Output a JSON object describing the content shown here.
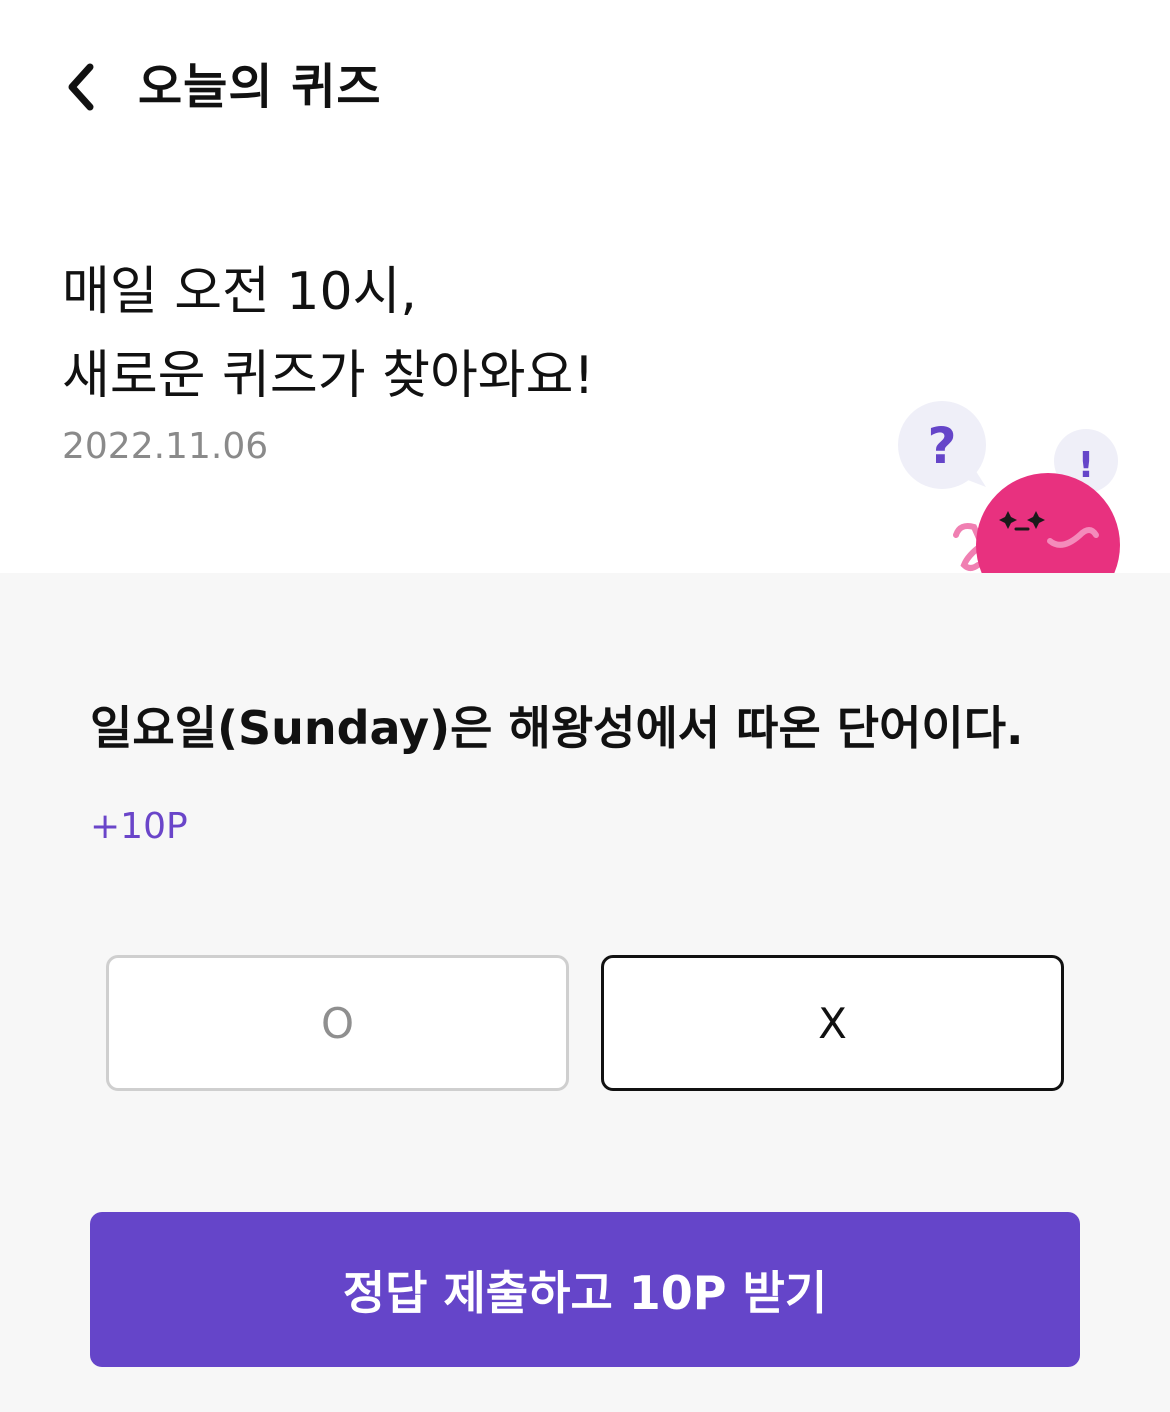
{
  "header": {
    "title": "오늘의 퀴즈",
    "back_icon": "chevron-left-icon"
  },
  "intro": {
    "line1": "매일 오전 10시,",
    "line2": "새로운 퀴즈가 찾아와요!",
    "date": "2022.11.06"
  },
  "mascot": {
    "question_mark": "?",
    "exclamation_mark": "!"
  },
  "quiz": {
    "question": "일요일(Sunday)은 해왕성에서 따온 단어이다.",
    "points": "+10P",
    "options": [
      {
        "label": "O",
        "selected": false
      },
      {
        "label": "X",
        "selected": true
      }
    ]
  },
  "submit": {
    "label": "정답 제출하고 10P 받기"
  },
  "colors": {
    "accent": "#6545c9",
    "points_text": "#6a45c9",
    "mascot_body": "#e8317f",
    "bubble": "#efeff8"
  }
}
